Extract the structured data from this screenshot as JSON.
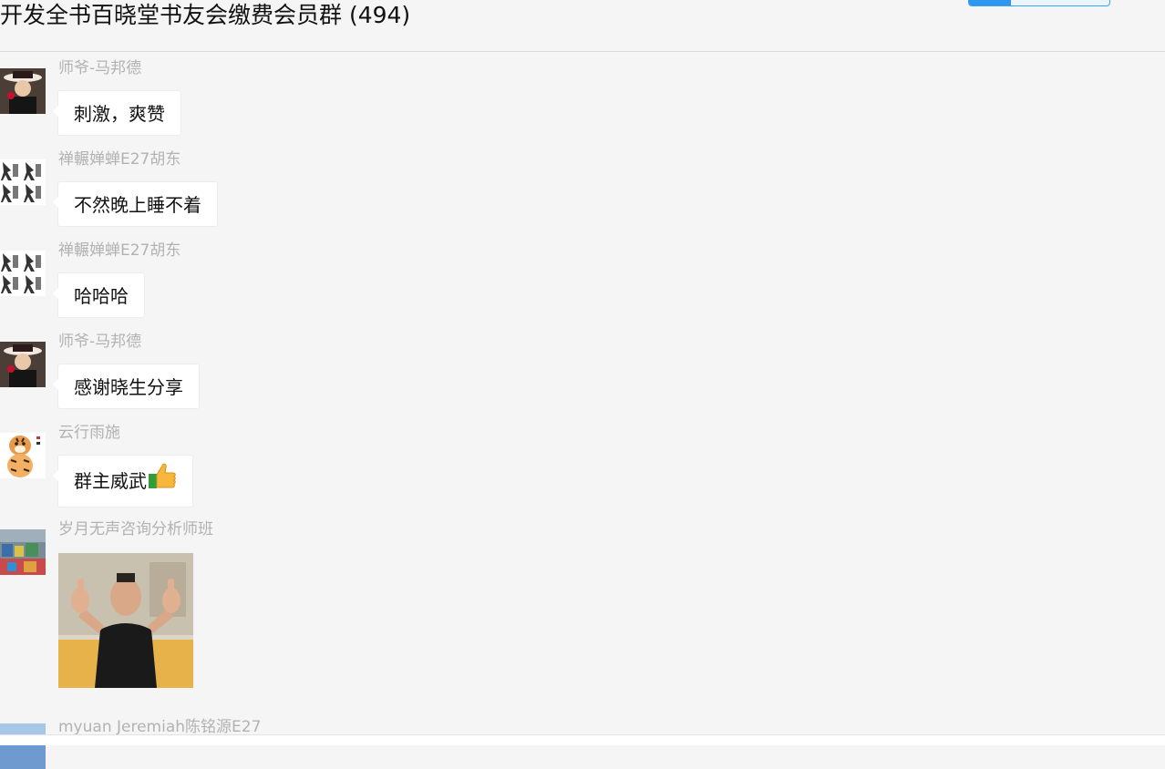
{
  "header": {
    "title": "开发全书百晓堂书友会缴费会员群 (494)",
    "accent_color": "#2e96ef"
  },
  "messages": [
    {
      "sender": "师爷-马邦德",
      "text": "刺激，爽赞",
      "avatar": "man-with-hat-avatar"
    },
    {
      "sender": "禅輾婵蝉E27胡东",
      "text": "不然晚上睡不着",
      "avatar": "figures-pattern-avatar"
    },
    {
      "sender": "禅輾婵蝉E27胡东",
      "text": "哈哈哈",
      "avatar": "figures-pattern-avatar"
    },
    {
      "sender": "师爷-马邦德",
      "text": "感谢晓生分享",
      "avatar": "man-with-hat-avatar"
    },
    {
      "sender": "云行雨施",
      "text": "群主威武",
      "emoji": "thumbs-up",
      "avatar": "tiger-avatar"
    },
    {
      "sender": "岁月无声咨询分析师班",
      "image": "man-thumbs-up-photo",
      "avatar": "colorful-scene-avatar"
    },
    {
      "sender": "myuan Jeremiah陈铭源E27",
      "avatar": "sky-avatar"
    }
  ]
}
